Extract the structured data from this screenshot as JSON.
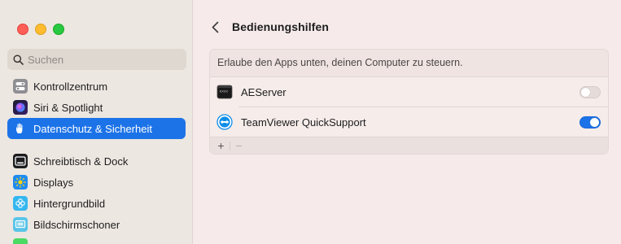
{
  "window": {
    "traffic_lights": [
      "close",
      "minimize",
      "zoom"
    ]
  },
  "sidebar": {
    "search": {
      "placeholder": "Suchen",
      "value": ""
    },
    "items": [
      {
        "label": "Kontrollzentrum",
        "icon": "control-center-icon",
        "color": "#8e8e93"
      },
      {
        "label": "Siri & Spotlight",
        "icon": "siri-icon",
        "color": "#5b3fd1"
      },
      {
        "label": "Datenschutz & Sicherheit",
        "icon": "hand-icon",
        "color": "#1c73e8",
        "selected": true
      },
      {
        "label": "Schreibtisch & Dock",
        "icon": "dock-icon",
        "color": "#1d1d1f"
      },
      {
        "label": "Displays",
        "icon": "sun-icon",
        "color": "#1f8bf0"
      },
      {
        "label": "Hintergrundbild",
        "icon": "wallpaper-icon",
        "color": "#34b7f0"
      },
      {
        "label": "Bildschirmschoner",
        "icon": "screensaver-icon",
        "color": "#5ac4e8"
      }
    ]
  },
  "main": {
    "title": "Bedienungshilfen",
    "description": "Erlaube den Apps unten, deinen Computer zu steuern.",
    "apps": [
      {
        "name": "AEServer",
        "icon": "terminal-icon",
        "enabled": false
      },
      {
        "name": "TeamViewer QuickSupport",
        "icon": "teamviewer-icon",
        "enabled": true
      }
    ],
    "footer": {
      "add_label": "+",
      "remove_label": "−"
    }
  },
  "colors": {
    "accent": "#1c73e8",
    "sidebar_bg": "#ede7e1",
    "content_bg": "#f6ebea"
  }
}
